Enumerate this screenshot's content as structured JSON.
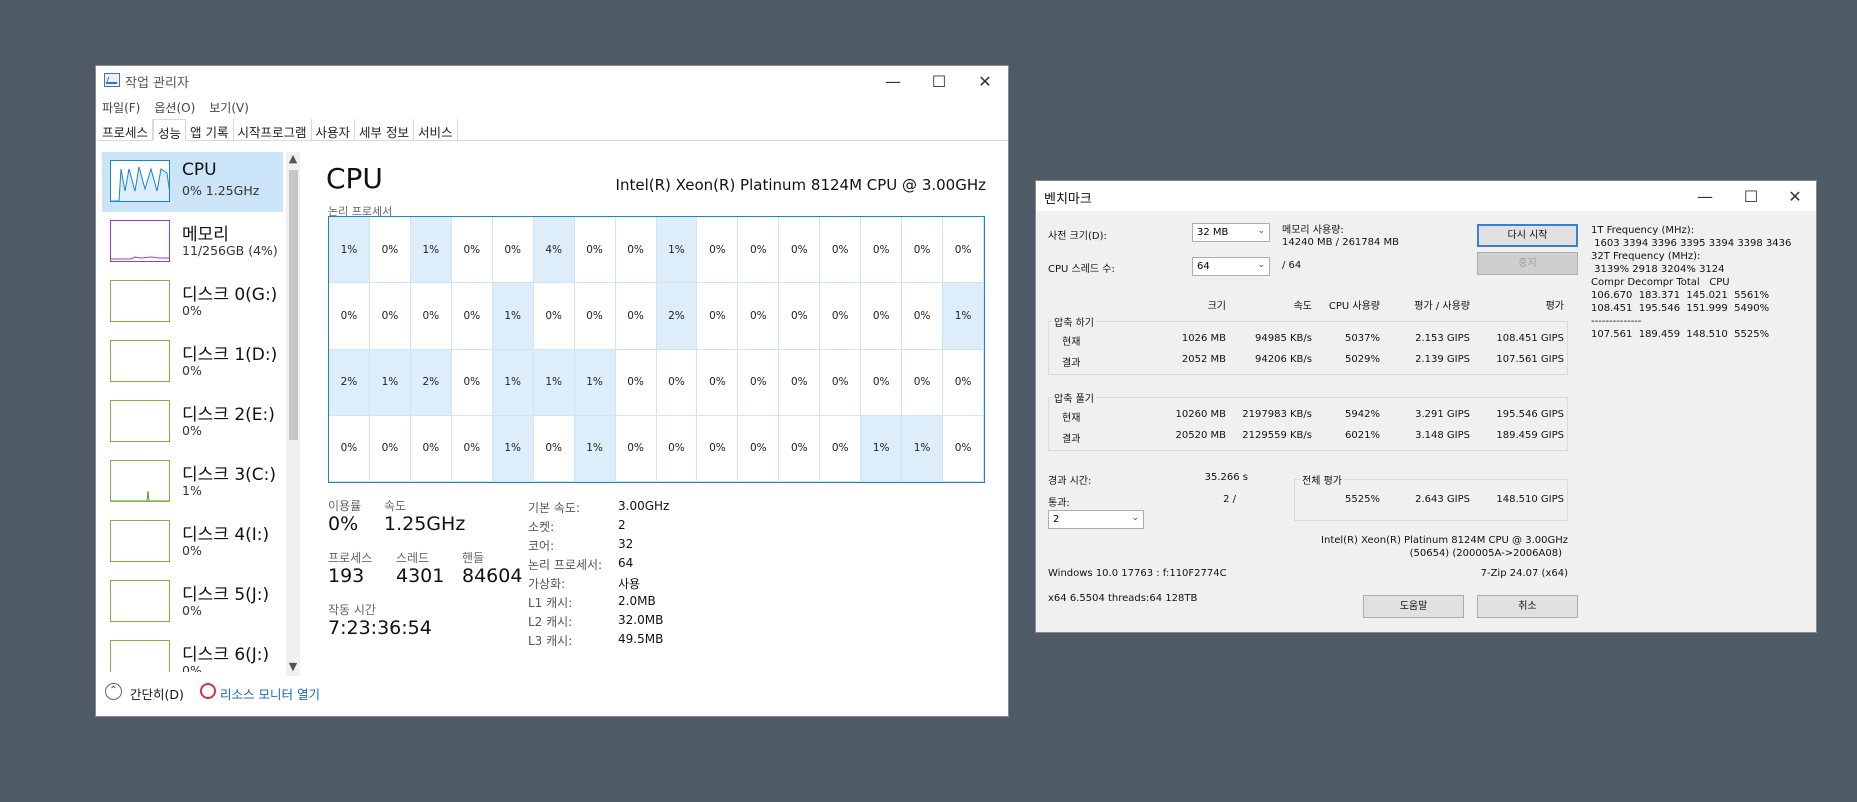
{
  "taskmanager": {
    "title": "작업 관리자",
    "menu": [
      "파일(F)",
      "옵션(O)",
      "보기(V)"
    ],
    "tabs": [
      "프로세스",
      "성능",
      "앱 기록",
      "시작프로그램",
      "사용자",
      "세부 정보",
      "서비스"
    ],
    "active_tab": "성능",
    "sidebar": [
      {
        "name": "CPU",
        "sub": "0% 1.25GHz"
      },
      {
        "name": "메모리",
        "sub": "11/256GB (4%)"
      },
      {
        "name": "디스크 0(G:)",
        "sub": "0%"
      },
      {
        "name": "디스크 1(D:)",
        "sub": "0%"
      },
      {
        "name": "디스크 2(E:)",
        "sub": "0%"
      },
      {
        "name": "디스크 3(C:)",
        "sub": "1%"
      },
      {
        "name": "디스크 4(I:)",
        "sub": "0%"
      },
      {
        "name": "디스크 5(J:)",
        "sub": "0%"
      },
      {
        "name": "디스크 6(J:)",
        "sub": "0%"
      }
    ],
    "header": {
      "title": "CPU",
      "model": "Intel(R) Xeon(R) Platinum 8124M CPU @ 3.00GHz"
    },
    "grid_label": "논리 프로세서",
    "cores": [
      "1%",
      "0%",
      "1%",
      "0%",
      "0%",
      "4%",
      "0%",
      "0%",
      "1%",
      "0%",
      "0%",
      "0%",
      "0%",
      "0%",
      "0%",
      "0%",
      "0%",
      "0%",
      "0%",
      "0%",
      "1%",
      "0%",
      "0%",
      "0%",
      "2%",
      "0%",
      "0%",
      "0%",
      "0%",
      "0%",
      "0%",
      "1%",
      "2%",
      "1%",
      "2%",
      "0%",
      "1%",
      "1%",
      "1%",
      "0%",
      "0%",
      "0%",
      "0%",
      "0%",
      "0%",
      "0%",
      "0%",
      "0%",
      "0%",
      "0%",
      "0%",
      "0%",
      "1%",
      "0%",
      "1%",
      "0%",
      "0%",
      "0%",
      "0%",
      "0%",
      "0%",
      "1%",
      "1%",
      "0%"
    ],
    "stats": {
      "util_label": "이용률",
      "util": "0%",
      "speed_label": "속도",
      "speed": "1.25GHz",
      "proc_label": "프로세스",
      "proc": "193",
      "thread_label": "스레드",
      "thread": "4301",
      "handle_label": "핸들",
      "handle": "84604",
      "uptime_label": "작동 시간",
      "uptime": "7:23:36:54"
    },
    "specs": [
      {
        "k": "기본 속도:",
        "v": "3.00GHz"
      },
      {
        "k": "소켓:",
        "v": "2"
      },
      {
        "k": "코어:",
        "v": "32"
      },
      {
        "k": "논리 프로세서:",
        "v": "64"
      },
      {
        "k": "가상화:",
        "v": "사용"
      },
      {
        "k": "L1 캐시:",
        "v": "2.0MB"
      },
      {
        "k": "L2 캐시:",
        "v": "32.0MB"
      },
      {
        "k": "L3 캐시:",
        "v": "49.5MB"
      }
    ],
    "footer": {
      "collapse": "간단히(D)",
      "monitor": "리소스 모니터 열기"
    }
  },
  "benchmark": {
    "title": "벤치마크",
    "dict_label": "사전 크기(D):",
    "dict_value": "32 MB",
    "mem_label": "메모리 사용량:",
    "mem_value": "14240 MB / 261784 MB",
    "threads_label": "CPU 스레드 수:",
    "threads_value": "64",
    "threads_max": "/ 64",
    "btn_restart": "다시 시작",
    "btn_stop": "중지",
    "cols": [
      "크기",
      "속도",
      "CPU 사용량",
      "평가 / 사용량",
      "평가"
    ],
    "compress_label": "압축 하기",
    "decompress_label": "압축 풀기",
    "rows": {
      "c_cur": [
        "현재",
        "1026 MB",
        "94985 KB/s",
        "5037%",
        "2.153 GIPS",
        "108.451 GIPS"
      ],
      "c_res": [
        "결과",
        "2052 MB",
        "94206 KB/s",
        "5029%",
        "2.139 GIPS",
        "107.561 GIPS"
      ],
      "d_cur": [
        "현재",
        "10260 MB",
        "2197983 KB/s",
        "5942%",
        "3.291 GIPS",
        "195.546 GIPS"
      ],
      "d_res": [
        "결과",
        "20520 MB",
        "2129559 KB/s",
        "6021%",
        "3.148 GIPS",
        "189.459 GIPS"
      ]
    },
    "elapsed_label": "경과 시간:",
    "elapsed": "35.266 s",
    "passes_label": "통과:",
    "passes": "2 /",
    "passes_select": "2",
    "total_label": "전체 평가",
    "total": [
      "5525%",
      "2.643 GIPS",
      "148.510 GIPS"
    ],
    "cpu_line1": "Intel(R) Xeon(R) Platinum 8124M CPU @ 3.00GHz",
    "cpu_line2": "(50654) (200005A->2006A08)",
    "os": "Windows 10.0 17763 : f:110F2774C",
    "version": "7-Zip 24.07 (x64)",
    "sys": "x64 6.5504 threads:64 128TB",
    "btn_help": "도움말",
    "btn_cancel": "취소",
    "freq_text": "1T Frequency (MHz):\n 1603 3394 3396 3395 3394 3398 3436\n32T Frequency (MHz):\n 3139% 2918 3204% 3124\nCompr Decompr Total   CPU\n106.670  183.371  145.021  5561%\n108.451  195.546  151.999  5490%\n--------------\n107.561  189.459  148.510  5525%"
  }
}
